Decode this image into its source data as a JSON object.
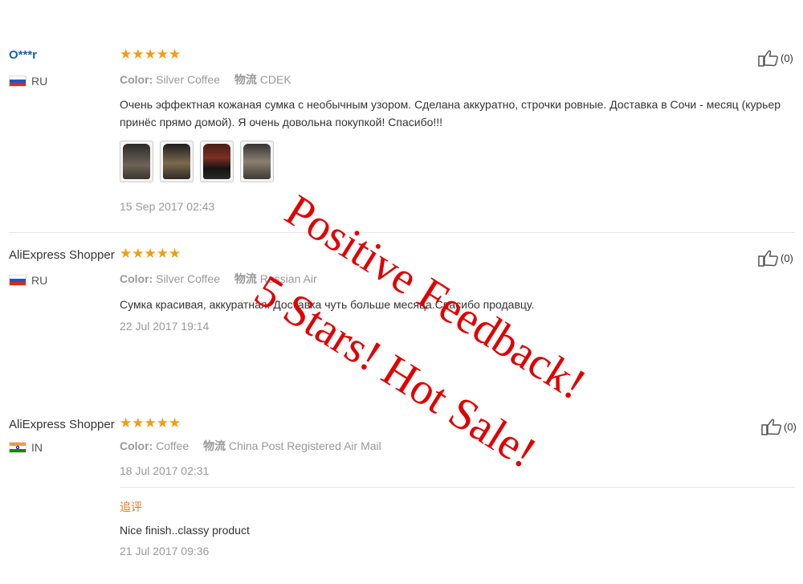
{
  "reviews": [
    {
      "user": "O***r",
      "country": "RU",
      "stars": "★★★★★",
      "color_label": "Color:",
      "color_value": "Silver Coffee",
      "shipping_label": "物流",
      "shipping_value": "CDEK",
      "text": "Очень эффектная кожаная сумка с необычным узором. Сделана аккуратно, строчки ровные. Доставка в Сочи - месяц (курьер принёс прямо домой). Я очень довольна покупкой! Спасибо!!!",
      "date": "15 Sep 2017 02:43",
      "helpful_count": "(0)"
    },
    {
      "user": "AliExpress Shopper",
      "country": "RU",
      "stars": "★★★★★",
      "color_label": "Color:",
      "color_value": "Silver Coffee",
      "shipping_label": "物流",
      "shipping_value": "Russian Air",
      "text": "Сумка красивая, аккуратная. Доставка чуть больше месяца.Спасибо продавцу.",
      "date": "22 Jul 2017 19:14",
      "helpful_count": "(0)"
    },
    {
      "user": "AliExpress Shopper",
      "country": "IN",
      "stars": "★★★★★",
      "color_label": "Color:",
      "color_value": "Coffee",
      "shipping_label": "物流",
      "shipping_value": "China Post Registered Air Mail",
      "date": "18 Jul 2017 02:31",
      "helpful_count": "(0)",
      "followup_label": "追评",
      "followup_text": "Nice finish..classy product",
      "followup_date": "21 Jul 2017 09:36"
    }
  ],
  "watermark": {
    "line1": "Positive Feedback!",
    "line2": "5 Stars! Hot Sale!"
  },
  "colors": {
    "star": "#f39c12",
    "watermark": "#e00000",
    "user_link": "#1a5fb4",
    "followup_label": "#e8751a"
  },
  "icons": [
    "thumbs-up-icon",
    "flag-ru-icon",
    "flag-in-icon",
    "star-icon"
  ]
}
